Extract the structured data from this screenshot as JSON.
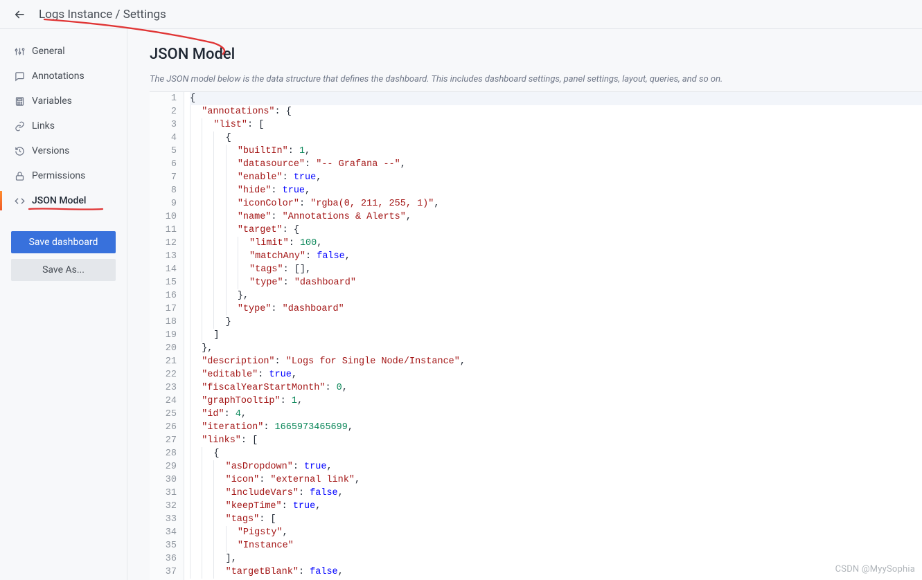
{
  "header": {
    "title": "Logs Instance / Settings"
  },
  "sidebar": {
    "items": [
      {
        "id": "general",
        "label": "General",
        "icon": "sliders-icon"
      },
      {
        "id": "annotations",
        "label": "Annotations",
        "icon": "comment-icon"
      },
      {
        "id": "variables",
        "label": "Variables",
        "icon": "calculator-icon"
      },
      {
        "id": "links",
        "label": "Links",
        "icon": "link-icon"
      },
      {
        "id": "versions",
        "label": "Versions",
        "icon": "history-icon"
      },
      {
        "id": "permissions",
        "label": "Permissions",
        "icon": "lock-icon"
      },
      {
        "id": "json-model",
        "label": "JSON Model",
        "icon": "code-icon",
        "active": true
      }
    ],
    "save_label": "Save dashboard",
    "save_as_label": "Save As..."
  },
  "main": {
    "title": "JSON Model",
    "description": "The JSON model below is the data structure that defines the dashboard. This includes dashboard settings, panel settings, layout, queries, and so on."
  },
  "editor": {
    "first_line": 1,
    "last_line": 37,
    "lines": [
      [
        0,
        [
          [
            "punc",
            "{"
          ]
        ]
      ],
      [
        1,
        [
          [
            "key",
            "\"annotations\""
          ],
          [
            "punc",
            ": {"
          ]
        ]
      ],
      [
        2,
        [
          [
            "key",
            "\"list\""
          ],
          [
            "punc",
            ": ["
          ]
        ]
      ],
      [
        3,
        [
          [
            "punc",
            "{"
          ]
        ]
      ],
      [
        4,
        [
          [
            "key",
            "\"builtIn\""
          ],
          [
            "punc",
            ": "
          ],
          [
            "num",
            "1"
          ],
          [
            "punc",
            ","
          ]
        ]
      ],
      [
        4,
        [
          [
            "key",
            "\"datasource\""
          ],
          [
            "punc",
            ": "
          ],
          [
            "str",
            "\"-- Grafana --\""
          ],
          [
            "punc",
            ","
          ]
        ]
      ],
      [
        4,
        [
          [
            "key",
            "\"enable\""
          ],
          [
            "punc",
            ": "
          ],
          [
            "bool",
            "true"
          ],
          [
            "punc",
            ","
          ]
        ]
      ],
      [
        4,
        [
          [
            "key",
            "\"hide\""
          ],
          [
            "punc",
            ": "
          ],
          [
            "bool",
            "true"
          ],
          [
            "punc",
            ","
          ]
        ]
      ],
      [
        4,
        [
          [
            "key",
            "\"iconColor\""
          ],
          [
            "punc",
            ": "
          ],
          [
            "str",
            "\"rgba(0, 211, 255, 1)\""
          ],
          [
            "punc",
            ","
          ]
        ]
      ],
      [
        4,
        [
          [
            "key",
            "\"name\""
          ],
          [
            "punc",
            ": "
          ],
          [
            "str",
            "\"Annotations & Alerts\""
          ],
          [
            "punc",
            ","
          ]
        ]
      ],
      [
        4,
        [
          [
            "key",
            "\"target\""
          ],
          [
            "punc",
            ": {"
          ]
        ]
      ],
      [
        5,
        [
          [
            "key",
            "\"limit\""
          ],
          [
            "punc",
            ": "
          ],
          [
            "num",
            "100"
          ],
          [
            "punc",
            ","
          ]
        ]
      ],
      [
        5,
        [
          [
            "key",
            "\"matchAny\""
          ],
          [
            "punc",
            ": "
          ],
          [
            "bool",
            "false"
          ],
          [
            "punc",
            ","
          ]
        ]
      ],
      [
        5,
        [
          [
            "key",
            "\"tags\""
          ],
          [
            "punc",
            ": [],"
          ]
        ]
      ],
      [
        5,
        [
          [
            "key",
            "\"type\""
          ],
          [
            "punc",
            ": "
          ],
          [
            "str",
            "\"dashboard\""
          ]
        ]
      ],
      [
        4,
        [
          [
            "punc",
            "},"
          ]
        ]
      ],
      [
        4,
        [
          [
            "key",
            "\"type\""
          ],
          [
            "punc",
            ": "
          ],
          [
            "str",
            "\"dashboard\""
          ]
        ]
      ],
      [
        3,
        [
          [
            "punc",
            "}"
          ]
        ]
      ],
      [
        2,
        [
          [
            "punc",
            "]"
          ]
        ]
      ],
      [
        1,
        [
          [
            "punc",
            "},"
          ]
        ]
      ],
      [
        1,
        [
          [
            "key",
            "\"description\""
          ],
          [
            "punc",
            ": "
          ],
          [
            "str",
            "\"Logs for Single Node/Instance\""
          ],
          [
            "punc",
            ","
          ]
        ]
      ],
      [
        1,
        [
          [
            "key",
            "\"editable\""
          ],
          [
            "punc",
            ": "
          ],
          [
            "bool",
            "true"
          ],
          [
            "punc",
            ","
          ]
        ]
      ],
      [
        1,
        [
          [
            "key",
            "\"fiscalYearStartMonth\""
          ],
          [
            "punc",
            ": "
          ],
          [
            "num",
            "0"
          ],
          [
            "punc",
            ","
          ]
        ]
      ],
      [
        1,
        [
          [
            "key",
            "\"graphTooltip\""
          ],
          [
            "punc",
            ": "
          ],
          [
            "num",
            "1"
          ],
          [
            "punc",
            ","
          ]
        ]
      ],
      [
        1,
        [
          [
            "key",
            "\"id\""
          ],
          [
            "punc",
            ": "
          ],
          [
            "num",
            "4"
          ],
          [
            "punc",
            ","
          ]
        ]
      ],
      [
        1,
        [
          [
            "key",
            "\"iteration\""
          ],
          [
            "punc",
            ": "
          ],
          [
            "num",
            "1665973465699"
          ],
          [
            "punc",
            ","
          ]
        ]
      ],
      [
        1,
        [
          [
            "key",
            "\"links\""
          ],
          [
            "punc",
            ": ["
          ]
        ]
      ],
      [
        2,
        [
          [
            "punc",
            "{"
          ]
        ]
      ],
      [
        3,
        [
          [
            "key",
            "\"asDropdown\""
          ],
          [
            "punc",
            ": "
          ],
          [
            "bool",
            "true"
          ],
          [
            "punc",
            ","
          ]
        ]
      ],
      [
        3,
        [
          [
            "key",
            "\"icon\""
          ],
          [
            "punc",
            ": "
          ],
          [
            "str",
            "\"external link\""
          ],
          [
            "punc",
            ","
          ]
        ]
      ],
      [
        3,
        [
          [
            "key",
            "\"includeVars\""
          ],
          [
            "punc",
            ": "
          ],
          [
            "bool",
            "false"
          ],
          [
            "punc",
            ","
          ]
        ]
      ],
      [
        3,
        [
          [
            "key",
            "\"keepTime\""
          ],
          [
            "punc",
            ": "
          ],
          [
            "bool",
            "true"
          ],
          [
            "punc",
            ","
          ]
        ]
      ],
      [
        3,
        [
          [
            "key",
            "\"tags\""
          ],
          [
            "punc",
            ": ["
          ]
        ]
      ],
      [
        4,
        [
          [
            "str",
            "\"Pigsty\""
          ],
          [
            "punc",
            ","
          ]
        ]
      ],
      [
        4,
        [
          [
            "str",
            "\"Instance\""
          ]
        ]
      ],
      [
        3,
        [
          [
            "punc",
            "],"
          ]
        ]
      ],
      [
        3,
        [
          [
            "key",
            "\"targetBlank\""
          ],
          [
            "punc",
            ": "
          ],
          [
            "bool",
            "false"
          ],
          [
            "punc",
            ","
          ]
        ]
      ]
    ]
  },
  "watermark": "CSDN @MyySophia"
}
